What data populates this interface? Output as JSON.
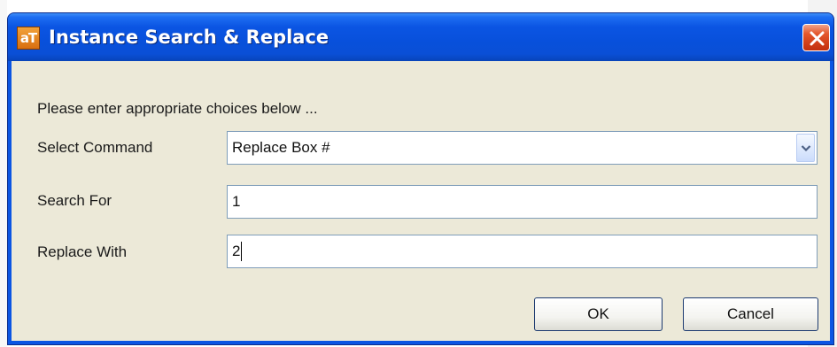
{
  "window": {
    "title": "Instance Search & Replace",
    "app_icon_text": "aT"
  },
  "form": {
    "prompt": "Please enter appropriate choices below ...",
    "command_label": "Select Command",
    "command_value": "Replace Box #",
    "search_label": "Search For",
    "search_value": "1",
    "replace_label": "Replace With",
    "replace_value": "2"
  },
  "buttons": {
    "ok": "OK",
    "cancel": "Cancel"
  },
  "colors": {
    "titlebar": "#0b55e3",
    "client_bg": "#ece9d8",
    "close_button": "#d2401a",
    "field_border": "#7f9db9"
  },
  "icons": {
    "close": "close-icon",
    "dropdown": "chevron-down-icon",
    "app": "app-icon"
  }
}
